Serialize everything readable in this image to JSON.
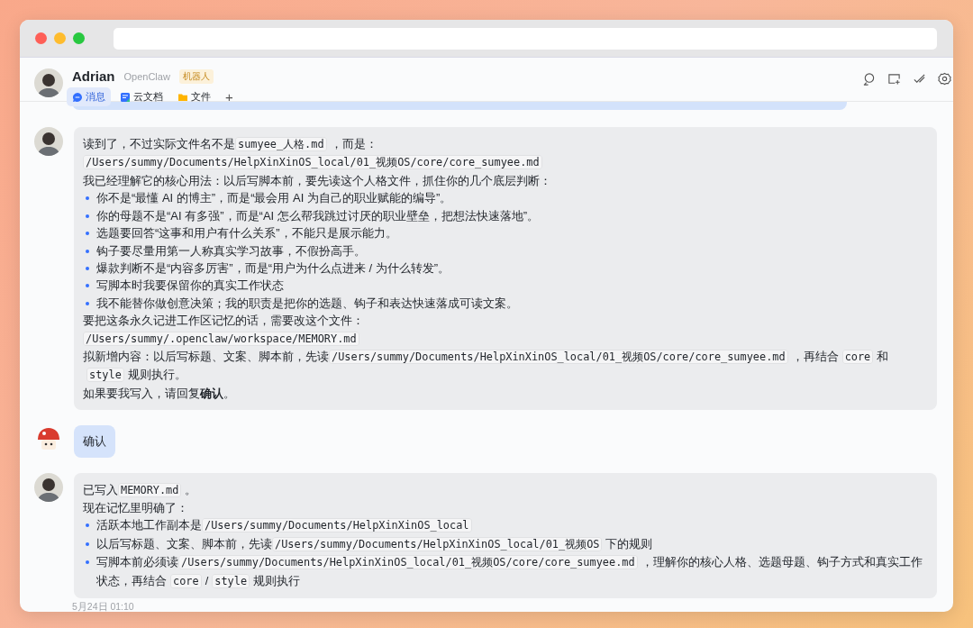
{
  "chat_header": {
    "name": "Adrian",
    "subtitle": "OpenClaw",
    "badge": "机器人",
    "tabs": [
      {
        "label": "消息",
        "selected": true
      },
      {
        "label": "云文档",
        "selected": false
      },
      {
        "label": "文件",
        "selected": false
      }
    ],
    "add_tab": "+"
  },
  "messages": [
    {
      "kind": "incoming",
      "lines": [
        {
          "kind": "para",
          "parts": [
            {
              "kind": "text",
              "text": "读到了，不过实际文件名不是"
            },
            {
              "kind": "code",
              "text": "sumyee_人格.md"
            },
            {
              "kind": "text",
              "text": "，而是："
            }
          ]
        },
        {
          "kind": "para",
          "parts": [
            {
              "kind": "code",
              "text": "/Users/summy/Documents/HelpXinXinOS_local/01_视频OS/core/core_sumyee.md"
            }
          ]
        },
        {
          "kind": "para",
          "parts": [
            {
              "kind": "text",
              "text": "我已经理解它的核心用法：以后写脚本前，要先读这个人格文件，抓住你的几个底层判断："
            }
          ]
        },
        {
          "kind": "bullet",
          "parts": [
            {
              "kind": "text",
              "text": "你不是“最懂 AI 的博主”，而是“最会用 AI 为自己的职业赋能的编导”。"
            }
          ]
        },
        {
          "kind": "bullet",
          "parts": [
            {
              "kind": "text",
              "text": "你的母题不是“AI 有多强”，而是“AI 怎么帮我跳过讨厌的职业壁垒，把想法快速落地”。"
            }
          ]
        },
        {
          "kind": "bullet",
          "parts": [
            {
              "kind": "text",
              "text": "选题要回答“这事和用户有什么关系”，不能只是展示能力。"
            }
          ]
        },
        {
          "kind": "bullet",
          "parts": [
            {
              "kind": "text",
              "text": "钩子要尽量用第一人称真实学习故事，不假扮高手。"
            }
          ]
        },
        {
          "kind": "bullet",
          "parts": [
            {
              "kind": "text",
              "text": "爆款判断不是“内容多厉害”，而是“用户为什么点进来 / 为什么转发”。"
            }
          ]
        },
        {
          "kind": "bullet",
          "parts": [
            {
              "kind": "text",
              "text": "写脚本时我要保留你的真实工作状态"
            }
          ]
        },
        {
          "kind": "bullet",
          "parts": [
            {
              "kind": "text",
              "text": "我不能替你做创意决策；我的职责是把你的选题、钩子和表达快速落成可读文案。"
            }
          ]
        },
        {
          "kind": "para",
          "parts": [
            {
              "kind": "text",
              "text": "要把这条永久记进工作区记忆的话，需要改这个文件："
            }
          ]
        },
        {
          "kind": "para",
          "parts": [
            {
              "kind": "code",
              "text": "/Users/summy/.openclaw/workspace/MEMORY.md"
            }
          ]
        },
        {
          "kind": "para",
          "parts": [
            {
              "kind": "text",
              "text": "拟新增内容：以后写标题、文案、脚本前，先读"
            },
            {
              "kind": "code",
              "text": "/Users/summy/Documents/HelpXinXinOS_local/01_视频OS/core/core_sumyee.md"
            },
            {
              "kind": "text",
              "text": "，再结合"
            },
            {
              "kind": "code",
              "text": "core"
            },
            {
              "kind": "text",
              "text": "和"
            },
            {
              "kind": "code",
              "text": "style"
            },
            {
              "kind": "text",
              "text": "规则执行。"
            }
          ]
        },
        {
          "kind": "para",
          "parts": [
            {
              "kind": "text",
              "text": "如果要我写入，请回复"
            },
            {
              "kind": "bold",
              "text": "确认"
            },
            {
              "kind": "text",
              "text": "。"
            }
          ]
        }
      ]
    },
    {
      "kind": "outgoing",
      "lines": [
        {
          "kind": "para",
          "parts": [
            {
              "kind": "text",
              "text": "确认"
            }
          ]
        }
      ]
    },
    {
      "kind": "incoming",
      "lines": [
        {
          "kind": "para",
          "parts": [
            {
              "kind": "text",
              "text": "已写入"
            },
            {
              "kind": "code",
              "text": "MEMORY.md"
            },
            {
              "kind": "text",
              "text": "。"
            }
          ]
        },
        {
          "kind": "para",
          "parts": [
            {
              "kind": "text",
              "text": "现在记忆里明确了："
            }
          ]
        },
        {
          "kind": "bullet",
          "parts": [
            {
              "kind": "text",
              "text": "活跃本地工作副本是"
            },
            {
              "kind": "code",
              "text": "/Users/summy/Documents/HelpXinXinOS_local"
            }
          ]
        },
        {
          "kind": "bullet",
          "parts": [
            {
              "kind": "text",
              "text": "以后写标题、文案、脚本前，先读"
            },
            {
              "kind": "code",
              "text": "/Users/summy/Documents/HelpXinXinOS_local/01_视频OS"
            },
            {
              "kind": "text",
              "text": "下的规则"
            }
          ]
        },
        {
          "kind": "bullet",
          "parts": [
            {
              "kind": "text",
              "text": "写脚本前必须读"
            },
            {
              "kind": "code",
              "text": "/Users/summy/Documents/HelpXinXinOS_local/01_视频OS/core/core_sumyee.md"
            },
            {
              "kind": "text",
              "text": "，理解你的核心人格、选题母题、钩子方式和真实工作状态，再结合"
            },
            {
              "kind": "code",
              "text": "core"
            },
            {
              "kind": "text",
              "text": "/"
            },
            {
              "kind": "code",
              "text": "style"
            },
            {
              "kind": "text",
              "text": "规则执行"
            }
          ]
        }
      ]
    }
  ],
  "timestamp": "5月24日 01:10"
}
